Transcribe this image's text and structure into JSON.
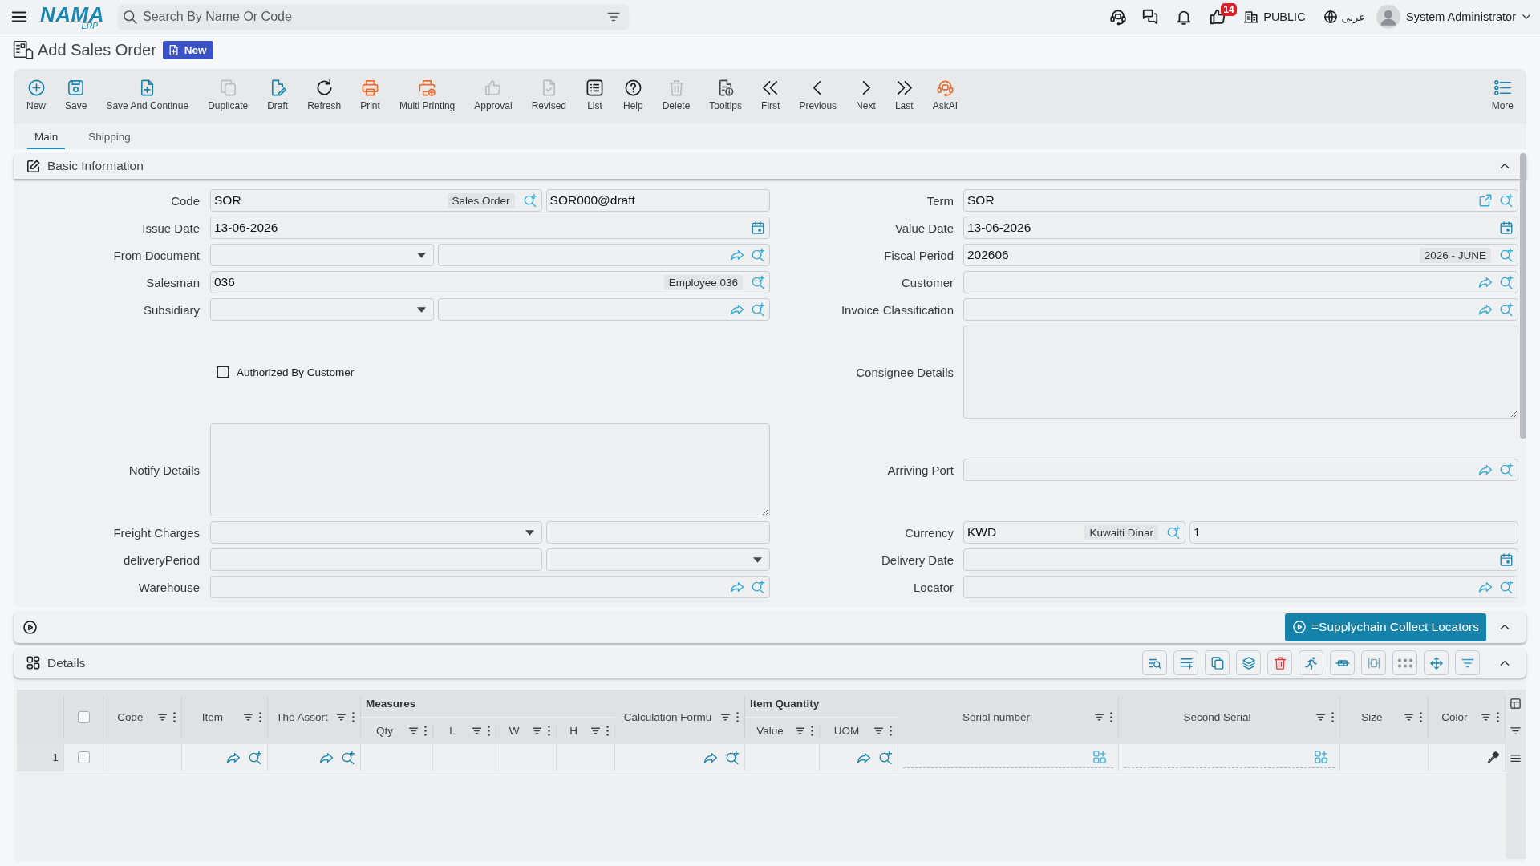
{
  "top_bar": {
    "logo": {
      "name": "NAMA",
      "suffix": "ERP"
    },
    "search": {
      "placeholder": "Search By Name Or Code"
    },
    "likes_badge": "14",
    "company": "PUBLIC",
    "language": "عربي",
    "user": "System Administrator"
  },
  "page_header": {
    "title": "Add Sales Order",
    "status": "New"
  },
  "toolbar": {
    "buttons": [
      {
        "label": "New",
        "disabled": false
      },
      {
        "label": "Save",
        "disabled": false
      },
      {
        "label": "Save And Continue",
        "disabled": false
      },
      {
        "label": "Duplicate",
        "disabled": true
      },
      {
        "label": "Draft",
        "disabled": false
      },
      {
        "label": "Refresh",
        "disabled": false
      },
      {
        "label": "Print",
        "disabled": false
      },
      {
        "label": "Multi Printing",
        "disabled": false
      },
      {
        "label": "Approval",
        "disabled": true
      },
      {
        "label": "Revised",
        "disabled": true
      },
      {
        "label": "List",
        "disabled": false
      },
      {
        "label": "Help",
        "disabled": false
      },
      {
        "label": "Delete",
        "disabled": true
      },
      {
        "label": "Tooltips",
        "disabled": false
      },
      {
        "label": "First",
        "disabled": false
      },
      {
        "label": "Previous",
        "disabled": false
      },
      {
        "label": "Next",
        "disabled": false
      },
      {
        "label": "Last",
        "disabled": false
      },
      {
        "label": "AskAI",
        "disabled": false
      }
    ],
    "more": "More"
  },
  "tabs": [
    {
      "label": "Main",
      "selected": true
    },
    {
      "label": "Shipping",
      "selected": false
    }
  ],
  "basic_information": {
    "title": "Basic Information",
    "expanded": true,
    "left_fields": [
      {
        "kind": "input",
        "label": "Code",
        "parts": [
          {
            "kind": "tagged",
            "value": "SOR",
            "tag": "Sales Order"
          },
          {
            "kind": "text",
            "value": "SOR000@draft"
          }
        ]
      },
      {
        "kind": "input",
        "label": "Issue Date",
        "parts": [
          {
            "kind": "date",
            "value": "13-06-2026"
          }
        ]
      },
      {
        "kind": "input",
        "label": "From Document",
        "parts": [
          {
            "kind": "select"
          },
          {
            "kind": "lookup"
          }
        ]
      },
      {
        "kind": "input",
        "label": "Salesman",
        "parts": [
          {
            "kind": "tagged",
            "value": "036",
            "tag": "Employee 036"
          }
        ]
      },
      {
        "kind": "input",
        "label": "Subsidiary",
        "parts": [
          {
            "kind": "select"
          },
          {
            "kind": "lookup"
          }
        ]
      },
      {
        "kind": "checkbox",
        "label": "Authorized By Customer",
        "checked": false
      },
      {
        "kind": "textarea",
        "label": "Notify Details"
      },
      {
        "kind": "input",
        "label": "Freight Charges",
        "parts": [
          {
            "kind": "select"
          },
          {
            "kind": "text"
          }
        ]
      },
      {
        "kind": "input",
        "label": "deliveryPeriod",
        "parts": [
          {
            "kind": "text"
          },
          {
            "kind": "select"
          }
        ]
      },
      {
        "kind": "input",
        "label": "Warehouse",
        "parts": [
          {
            "kind": "lookup"
          }
        ]
      }
    ],
    "right_fields": [
      {
        "kind": "input",
        "label": "Term",
        "parts": [
          {
            "kind": "linked",
            "value": "SOR"
          }
        ]
      },
      {
        "kind": "input",
        "label": "Value Date",
        "parts": [
          {
            "kind": "date",
            "value": "13-06-2026"
          }
        ]
      },
      {
        "kind": "input",
        "label": "Fiscal Period",
        "parts": [
          {
            "kind": "tagged",
            "value": "202606",
            "tag": "2026 - JUNE"
          }
        ]
      },
      {
        "kind": "input",
        "label": "Customer",
        "parts": [
          {
            "kind": "lookup"
          }
        ]
      },
      {
        "kind": "input",
        "label": "Invoice Classification",
        "parts": [
          {
            "kind": "lookup"
          }
        ]
      },
      {
        "kind": "textarea",
        "label": "Consignee Details"
      },
      {
        "kind": "input",
        "label": "Arriving Port",
        "parts": [
          {
            "kind": "lookup"
          }
        ]
      },
      {
        "kind": "input",
        "label": "Currency",
        "parts": [
          {
            "kind": "tagged",
            "value": "KWD",
            "tag": "Kuwaiti Dinar"
          },
          {
            "kind": "text",
            "value": "1"
          }
        ]
      },
      {
        "kind": "input",
        "label": "Delivery Date",
        "parts": [
          {
            "kind": "date"
          }
        ]
      },
      {
        "kind": "input",
        "label": "Locator",
        "parts": [
          {
            "kind": "lookup"
          }
        ]
      }
    ]
  },
  "actions_bar": {
    "button": "=Supplychain Collect Locators",
    "expanded": true
  },
  "details": {
    "title": "Details",
    "expanded": true,
    "table": {
      "select_all": false,
      "columns": [
        {
          "kind": "plain",
          "label": "Code"
        },
        {
          "kind": "lookup",
          "label": "Item"
        },
        {
          "kind": "lookup",
          "label": "The Assort"
        },
        {
          "kind": "group",
          "label": "Measures",
          "columns": [
            {
              "kind": "plain",
              "label": "Qty"
            },
            {
              "kind": "plain",
              "label": "L"
            },
            {
              "kind": "plain",
              "label": "W"
            },
            {
              "kind": "plain",
              "label": "H"
            }
          ]
        },
        {
          "kind": "lookup",
          "label": "Calculation Formu"
        },
        {
          "kind": "group",
          "label": "Item Quantity",
          "columns": [
            {
              "kind": "plain",
              "label": "Value"
            },
            {
              "kind": "lookup",
              "label": "UOM"
            }
          ]
        },
        {
          "kind": "serial",
          "label": "Serial number"
        },
        {
          "kind": "serial",
          "label": "Second Serial"
        },
        {
          "kind": "plain",
          "label": "Size"
        },
        {
          "kind": "color",
          "label": "Color"
        }
      ],
      "rows": [
        {
          "number": "1",
          "selected": false
        }
      ]
    }
  }
}
